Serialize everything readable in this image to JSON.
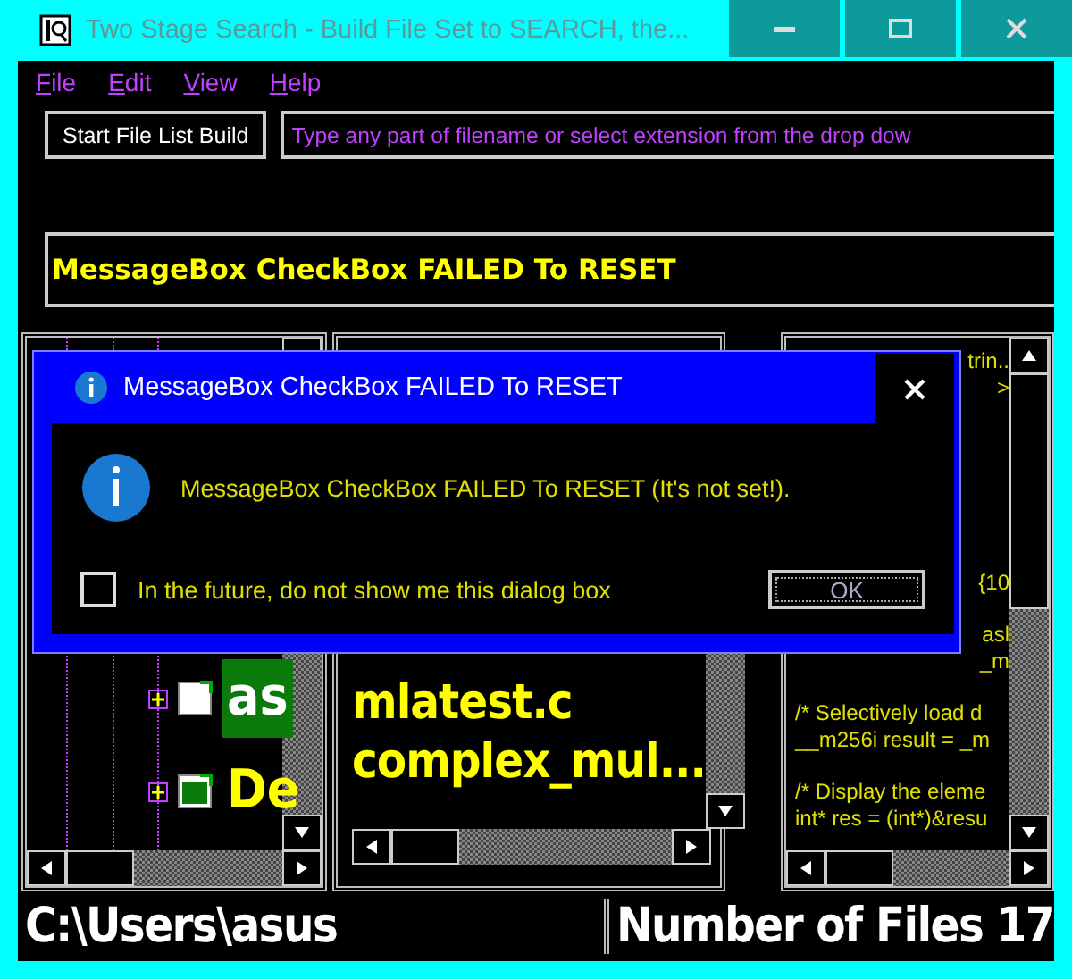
{
  "window": {
    "title": "Two Stage Search - Build File Set to SEARCH, the..."
  },
  "menu": [
    "File",
    "Edit",
    "View",
    "Help"
  ],
  "toolbar": {
    "build_button": "Start File List Build",
    "search_field": {
      "placeholder": "Type any part of filename or select extension from the drop dow"
    }
  },
  "message": "MessageBox CheckBox FAILED To RESET",
  "tree": {
    "items": [
      {
        "label": "as",
        "selected": true,
        "expanded": false
      },
      {
        "label": "De",
        "selected": false,
        "expanded": false
      }
    ]
  },
  "file_list": {
    "items": [
      "mlatest.c",
      "complex_mul..."
    ]
  },
  "code": {
    "blocks": [
      {
        "kind": "fragment",
        "lines": [
          "trin..",
          ">"
        ]
      },
      {
        "kind": "fragment",
        "lines": [
          "{10"
        ]
      },
      {
        "kind": "fragment",
        "lines": [
          "asl",
          "_m"
        ]
      },
      {
        "kind": "code",
        "lines": [
          "/* Selectively load d",
          "__m256i result = _m"
        ]
      },
      {
        "kind": "code",
        "lines": [
          "/* Display the eleme",
          "int* res = (int*)&resu"
        ]
      }
    ]
  },
  "dialog": {
    "title": "MessageBox CheckBox FAILED To RESET",
    "text": "MessageBox CheckBox FAILED To RESET (It's not set!).",
    "checkbox": {
      "label": "In the future, do not show me this dialog box",
      "checked": false
    },
    "ok_button": "OK"
  },
  "status_bar": {
    "path": "C:\\Users\\asus",
    "count": "Number of Files 17"
  }
}
